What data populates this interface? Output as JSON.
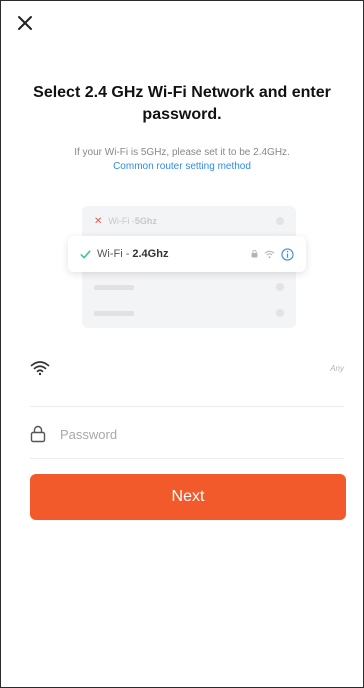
{
  "header": {
    "close_icon": "close-icon"
  },
  "main": {
    "title": "Select 2.4 GHz Wi-Fi Network and enter password.",
    "subtitle": "If your Wi-Fi is 5GHz, please set it to be 2.4GHz.",
    "router_link": "Common router setting method"
  },
  "illustration": {
    "row_5g_prefix": "Wi-Fi - ",
    "row_5g_band": "5Ghz",
    "row_24g_prefix": "Wi-Fi - ",
    "row_24g_band": "2.4Ghz"
  },
  "form": {
    "ssid_value": "",
    "ssid_switch": "Any",
    "password_placeholder": "Password",
    "password_value": ""
  },
  "actions": {
    "next_label": "Next"
  },
  "colors": {
    "accent": "#f2592b",
    "link": "#2f8de4"
  }
}
